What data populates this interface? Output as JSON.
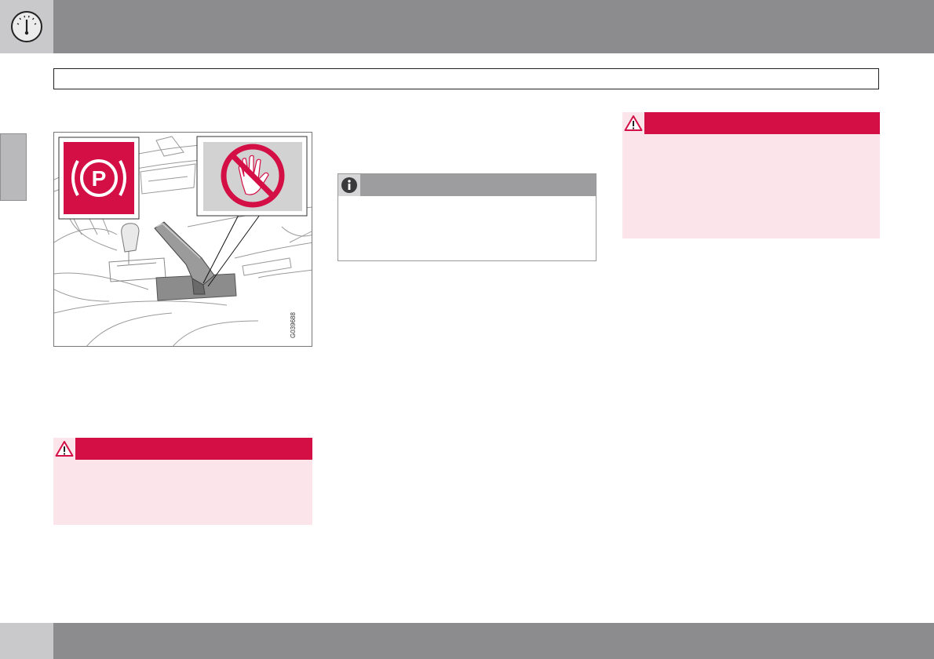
{
  "header": {
    "icon": "gauge-icon"
  },
  "section_title": "",
  "figure": {
    "code": "G039688",
    "icons": [
      "parking-brake-icon",
      "no-hand-icon"
    ]
  },
  "colors": {
    "band_gray": "#8c8c8f",
    "corner_gray": "#c9c9cb",
    "warning_red": "#d40f45",
    "warning_bg": "#fbe5eb",
    "note_gray": "#9d9d9f"
  },
  "warnings": [
    {
      "icon": "warning-triangle-icon"
    },
    {
      "icon": "warning-triangle-icon"
    }
  ],
  "note": {
    "icon": "info-icon"
  }
}
